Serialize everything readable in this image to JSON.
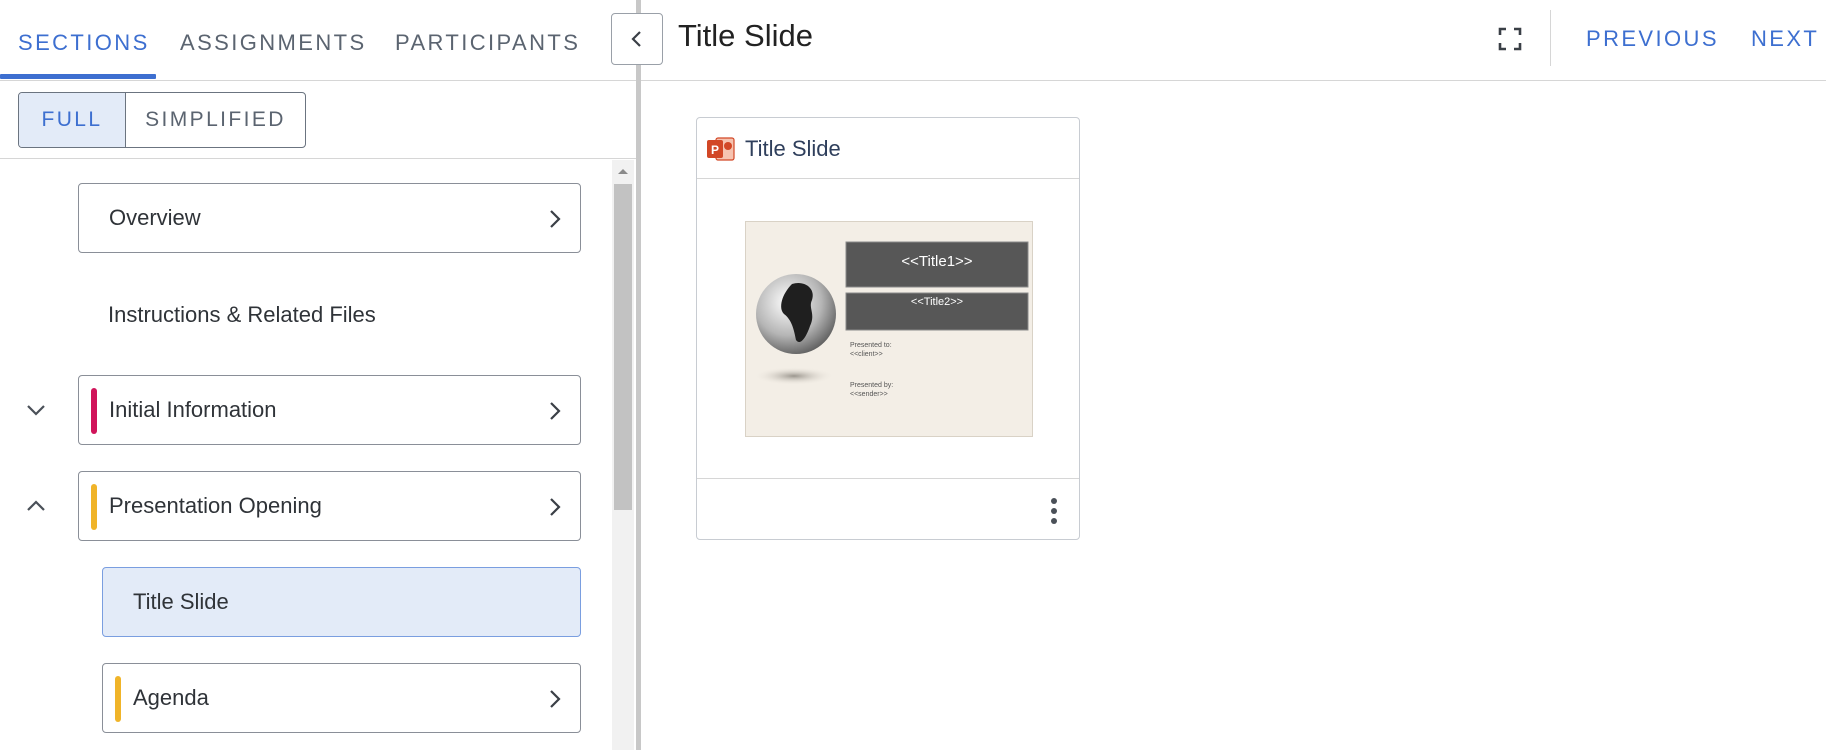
{
  "tabs": [
    {
      "label": "SECTIONS",
      "active": true
    },
    {
      "label": "ASSIGNMENTS",
      "active": false
    },
    {
      "label": "PARTICIPANTS",
      "active": false
    }
  ],
  "view_toggle": {
    "full": "FULL",
    "simplified": "SIMPLIFIED",
    "selected": "FULL"
  },
  "sections": [
    {
      "label": "Overview"
    },
    {
      "label": "Instructions & Related Files"
    },
    {
      "label": "Initial Information",
      "color": "#d0145a",
      "expanded": false
    },
    {
      "label": "Presentation Opening",
      "color": "#f0b429",
      "expanded": true
    },
    {
      "label": "Title Slide",
      "selected": true
    },
    {
      "label": "Agenda",
      "color": "#f0b429"
    }
  ],
  "header": {
    "title": "Title Slide",
    "previous": "PREVIOUS",
    "next": "NEXT"
  },
  "file_card": {
    "name": "Title Slide",
    "icon": "powerpoint-icon",
    "thumbnail": {
      "title1": "<<Title1>>",
      "title2": "<<Title2>>",
      "presented_to": "Presented to:",
      "client": "<<client>>",
      "presented_by": "Presented by:",
      "sender": "<<sender>>"
    }
  },
  "colors": {
    "accent": "#3d6fd0",
    "selected_bg": "#e3ebf8",
    "initial_info": "#d0145a",
    "presentation": "#f0b429"
  }
}
